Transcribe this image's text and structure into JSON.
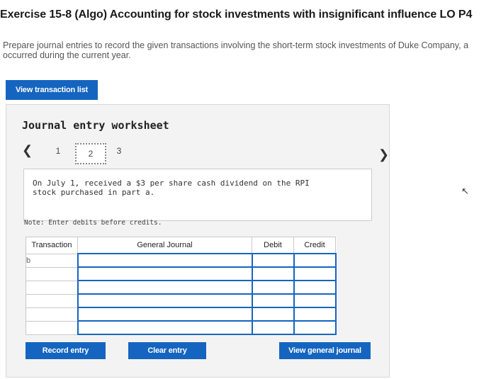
{
  "title": "Exercise 15-8 (Algo) Accounting for stock investments with insignificant influence LO P4",
  "instructions": [
    "Prepare journal entries to record the given transactions involving the short-term stock investments of Duke Company, a",
    "occurred during the current year."
  ],
  "view_transaction_label": "View transaction list",
  "worksheet": {
    "title": "Journal entry worksheet",
    "pages": [
      "1",
      "2",
      "3"
    ],
    "current_page": 2,
    "description": "On July 1, received a $3 per share cash dividend on the RPI stock purchased in part a.",
    "note": "Note: Enter debits before credits.",
    "table": {
      "headers": [
        "Transaction",
        "General Journal",
        "Debit",
        "Credit"
      ],
      "transaction_value": "b"
    }
  },
  "buttons": {
    "record": "Record entry",
    "clear": "Clear entry",
    "general": "View general journal"
  },
  "icons": {
    "prev": "chevron-left-icon",
    "next": "chevron-right-icon",
    "cursor": "mouse-pointer-icon"
  },
  "colors": {
    "accent": "#1565c0"
  }
}
